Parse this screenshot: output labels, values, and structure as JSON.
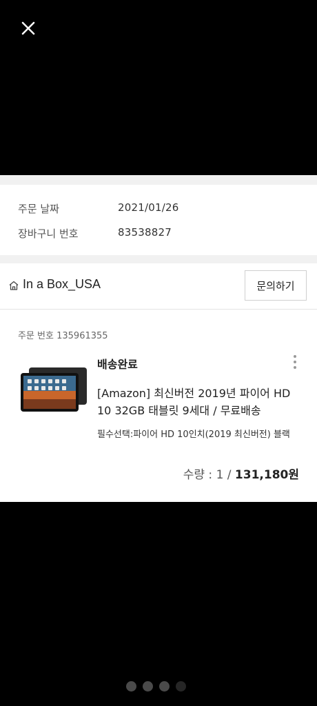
{
  "viewer": {
    "close_icon": "close-icon",
    "pager": {
      "count": 4,
      "active_indices": [
        0,
        1,
        2
      ],
      "dim_indices": [
        3
      ]
    }
  },
  "order_info": {
    "date_label": "주문 날짜",
    "date_value": "2021/01/26",
    "cart_label": "장바구니 번호",
    "cart_value": "83538827"
  },
  "seller": {
    "icon": "home-icon",
    "name": "In a Box_USA",
    "inquiry_button": "문의하기"
  },
  "item": {
    "order_number": "주문 번호 135961355",
    "status": "배송완료",
    "title": "[Amazon] 최신버전 2019년 파이어 HD 10 32GB 태블릿 9세대 / 무료배송",
    "option": "필수선택:파이어 HD 10인치(2019 최신버전) 블랙",
    "quantity_text": "수량 : 1 / ",
    "price": "131,180원",
    "more_icon": "more-vertical-icon"
  }
}
